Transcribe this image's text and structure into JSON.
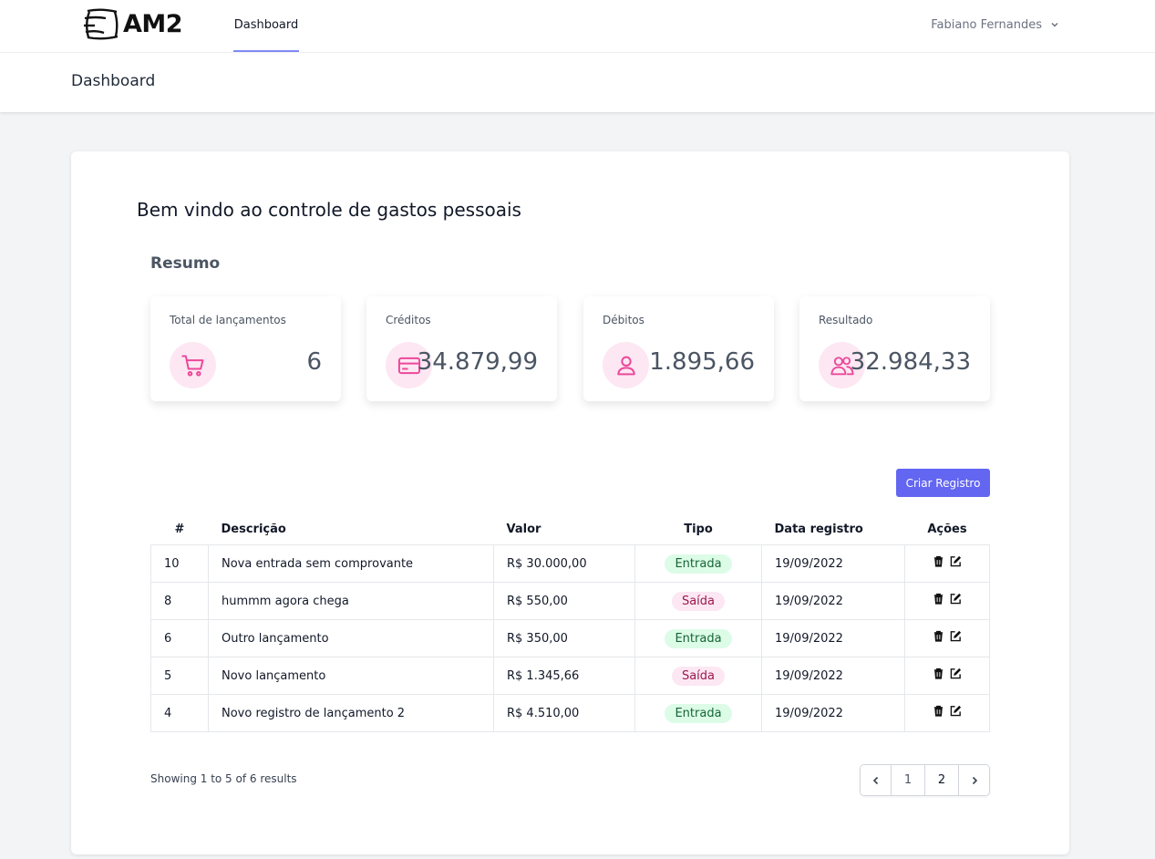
{
  "brand": {
    "name": "AM2"
  },
  "nav": {
    "dashboard": "Dashboard"
  },
  "user": {
    "name": "Fabiano Fernandes"
  },
  "header": {
    "title": "Dashboard"
  },
  "main": {
    "welcome": "Bem vindo ao controle de gastos pessoais",
    "summary_title": "Resumo",
    "stats": [
      {
        "label": "Total de lançamentos",
        "value": "6",
        "icon": "cart-icon"
      },
      {
        "label": "Créditos",
        "value": "34.879,99",
        "icon": "credit-card-icon"
      },
      {
        "label": "Débitos",
        "value": "1.895,66",
        "icon": "user-icon"
      },
      {
        "label": "Resultado",
        "value": "32.984,33",
        "icon": "users-icon"
      }
    ],
    "create_button": "Criar Registro"
  },
  "table": {
    "headers": {
      "id": "#",
      "descricao": "Descrição",
      "valor": "Valor",
      "tipo": "Tipo",
      "data": "Data registro",
      "acoes": "Ações"
    },
    "rows": [
      {
        "id": "10",
        "descricao": "Nova entrada sem comprovante",
        "valor": "R$ 30.000,00",
        "tipo": "Entrada",
        "data": "19/09/2022"
      },
      {
        "id": "8",
        "descricao": "hummm agora chega",
        "valor": "R$ 550,00",
        "tipo": "Saída",
        "data": "19/09/2022"
      },
      {
        "id": "6",
        "descricao": "Outro lançamento",
        "valor": "R$ 350,00",
        "tipo": "Entrada",
        "data": "19/09/2022"
      },
      {
        "id": "5",
        "descricao": "Novo lançamento",
        "valor": "R$ 1.345,66",
        "tipo": "Saída",
        "data": "19/09/2022"
      },
      {
        "id": "4",
        "descricao": "Novo registro de lançamento 2",
        "valor": "R$ 4.510,00",
        "tipo": "Entrada",
        "data": "19/09/2022"
      }
    ]
  },
  "pagination": {
    "summary": "Showing 1 to 5 of 6 results",
    "pages": [
      "1",
      "2"
    ]
  },
  "colors": {
    "accent": "#6366f1",
    "icon_pink": "#ec4899",
    "entrada_bg": "#dcfce7",
    "saida_bg": "#fce7f3"
  }
}
